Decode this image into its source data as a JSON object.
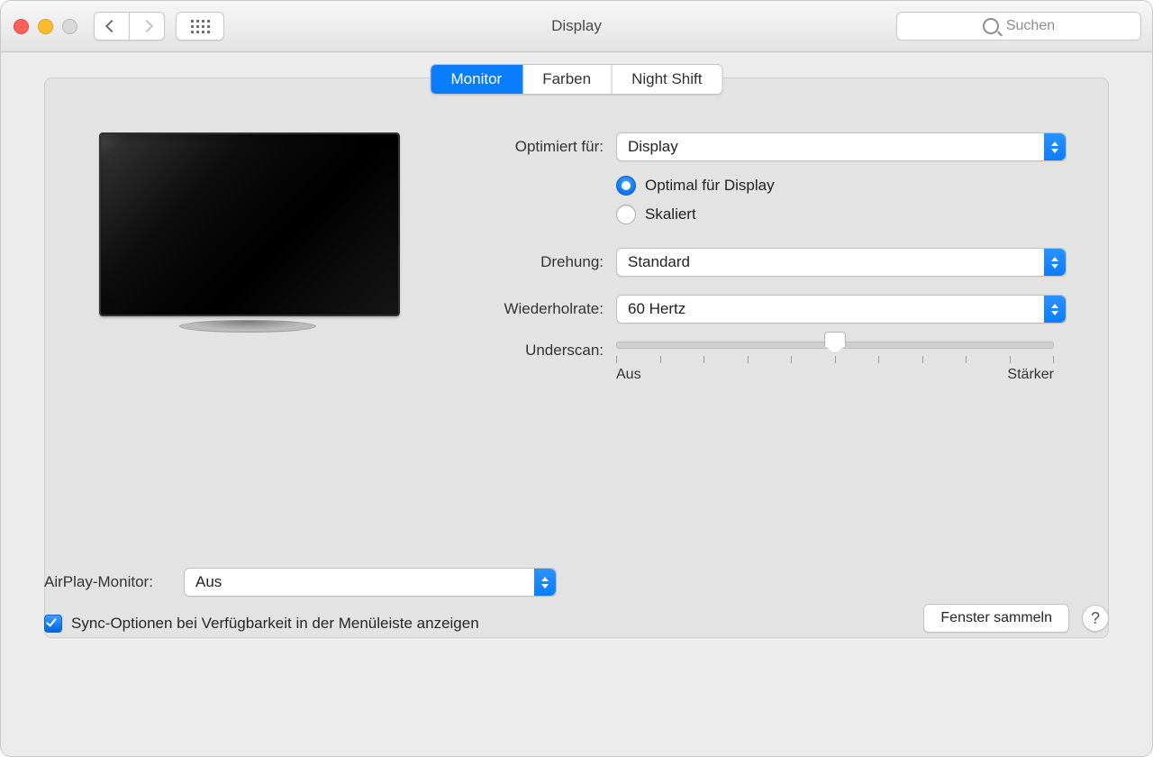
{
  "window": {
    "title": "Display"
  },
  "toolbar": {
    "back_enabled": true,
    "forward_enabled": false
  },
  "search": {
    "placeholder": "Suchen"
  },
  "tabs": [
    {
      "id": "monitor",
      "label": "Monitor",
      "active": true
    },
    {
      "id": "farben",
      "label": "Farben",
      "active": false
    },
    {
      "id": "nightshift",
      "label": "Night Shift",
      "active": false
    }
  ],
  "form": {
    "optimized_for": {
      "label": "Optimiert für:",
      "value": "Display"
    },
    "resolution_mode": {
      "options": [
        {
          "label": "Optimal für Display",
          "checked": true
        },
        {
          "label": "Skaliert",
          "checked": false
        }
      ]
    },
    "rotation": {
      "label": "Drehung:",
      "value": "Standard"
    },
    "refresh": {
      "label": "Wiederholrate:",
      "value": "60 Hertz"
    },
    "underscan": {
      "label": "Underscan:",
      "left_label": "Aus",
      "right_label": "Stärker",
      "ticks": 11,
      "value_percent": 50
    }
  },
  "airplay": {
    "label": "AirPlay-Monitor:",
    "value": "Aus"
  },
  "sync_check": {
    "checked": true,
    "label": "Sync-Optionen bei Verfügbarkeit in der Menüleiste anzeigen"
  },
  "buttons": {
    "gather": "Fenster sammeln"
  }
}
